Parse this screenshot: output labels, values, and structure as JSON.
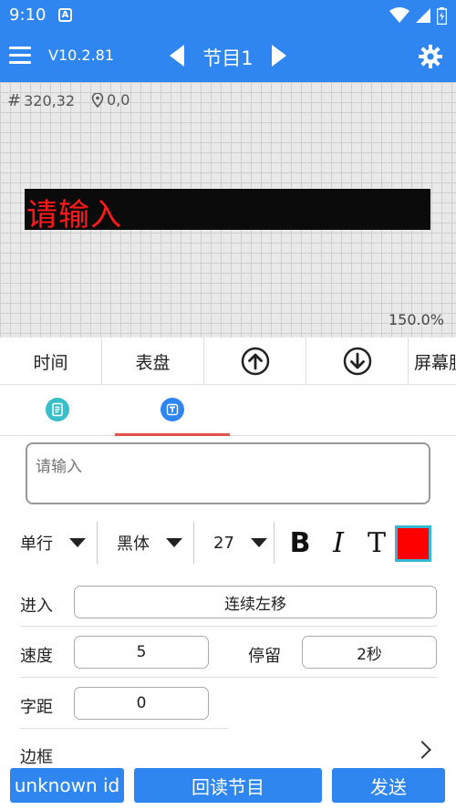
{
  "status_bar": {
    "time": "9:10",
    "notification_icon": "A"
  },
  "toolbar": {
    "version": "V10.2.81",
    "program_title": "节目1"
  },
  "canvas": {
    "size_readout": "320,32",
    "position_readout": "0,0",
    "led_text": "请输入",
    "led_text_color": "#ff1a1a",
    "led_background": "#0b0b0b",
    "zoom": "150.0%"
  },
  "actions": {
    "time_label": "时间",
    "dial_label": "表盘",
    "move_up_icon": "arrow-up-circle-icon",
    "move_down_icon": "arrow-down-circle-icon",
    "screen_label": "屏幕脱"
  },
  "tabs": {
    "tab1_icon": "document-icon",
    "tab1_color": "#39bfc9",
    "tab2_icon": "text-icon",
    "tab2_color": "#2f86f0",
    "active_tab_underline": "#e0524c"
  },
  "text_input": {
    "placeholder": "请输入",
    "value": ""
  },
  "format": {
    "line_mode": "单行",
    "font": "黑体",
    "font_size": "27",
    "bold": "B",
    "italic": "I",
    "text_style": "T",
    "text_color": "#ff0000"
  },
  "form": {
    "enter_label": "进入",
    "enter_value": "连续左移",
    "speed_label": "速度",
    "speed_value": "5",
    "stay_label": "停留",
    "stay_value": "2秒",
    "spacing_label": "字距",
    "spacing_value": "0",
    "border_label": "边框"
  },
  "bottom": {
    "device_id": "unknown id",
    "read_back": "回读节目",
    "send": "发送"
  },
  "colors": {
    "primary": "#2f86f0"
  }
}
